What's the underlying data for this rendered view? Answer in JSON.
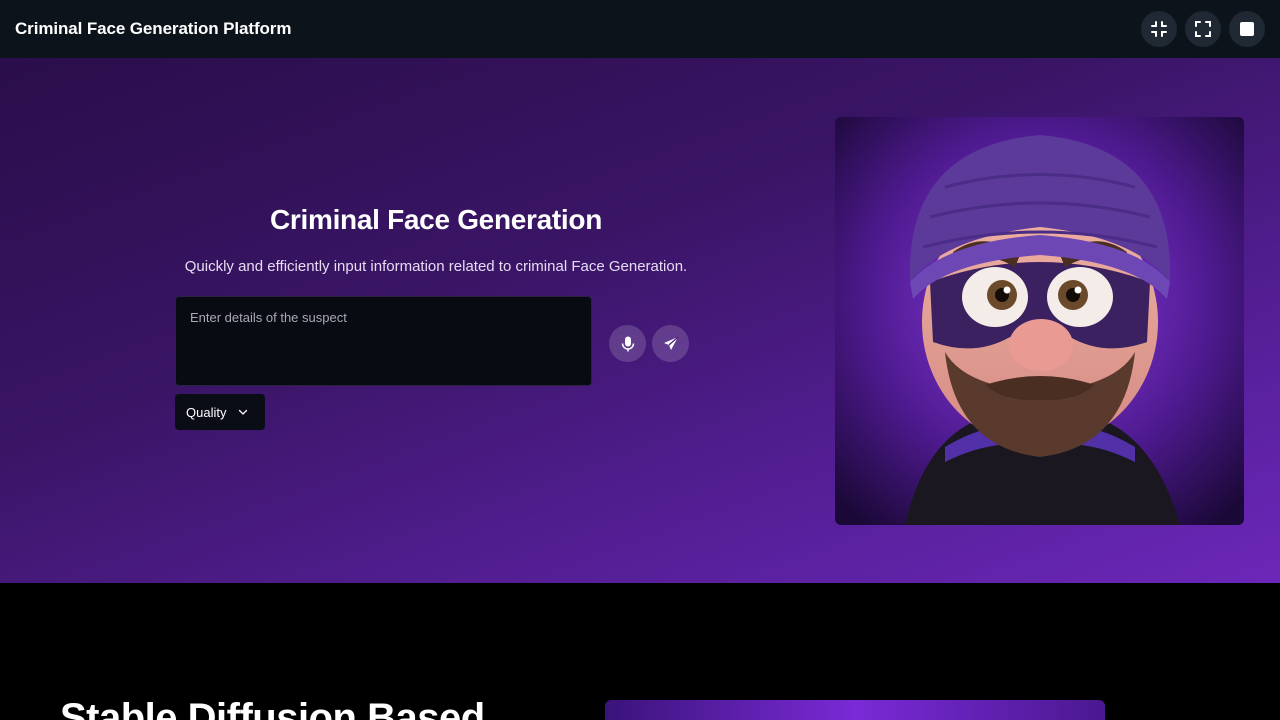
{
  "app": {
    "title": "Criminal Face Generation Platform"
  },
  "toolbar": {
    "buttons": [
      {
        "name": "exit-fullscreen",
        "icon": "collapse-icon"
      },
      {
        "name": "fullscreen",
        "icon": "expand-icon"
      },
      {
        "name": "stop",
        "icon": "square-icon"
      }
    ]
  },
  "hero": {
    "title": "Criminal Face Generation",
    "subtitle": "Quickly and efficiently input information related to criminal Face Generation.",
    "input": {
      "placeholder": "Enter details of the suspect",
      "value": ""
    },
    "mic_icon": "microphone-icon",
    "send_icon": "send-icon",
    "quality_label": "Quality",
    "quality_icon": "chevron-down-icon"
  },
  "lower": {
    "title": "Stable Diffusion Based"
  },
  "colors": {
    "topbar": "#0d131a",
    "hero_start": "#2a0d4a",
    "hero_end": "#6c27b8",
    "input_bg": "#080b12"
  }
}
